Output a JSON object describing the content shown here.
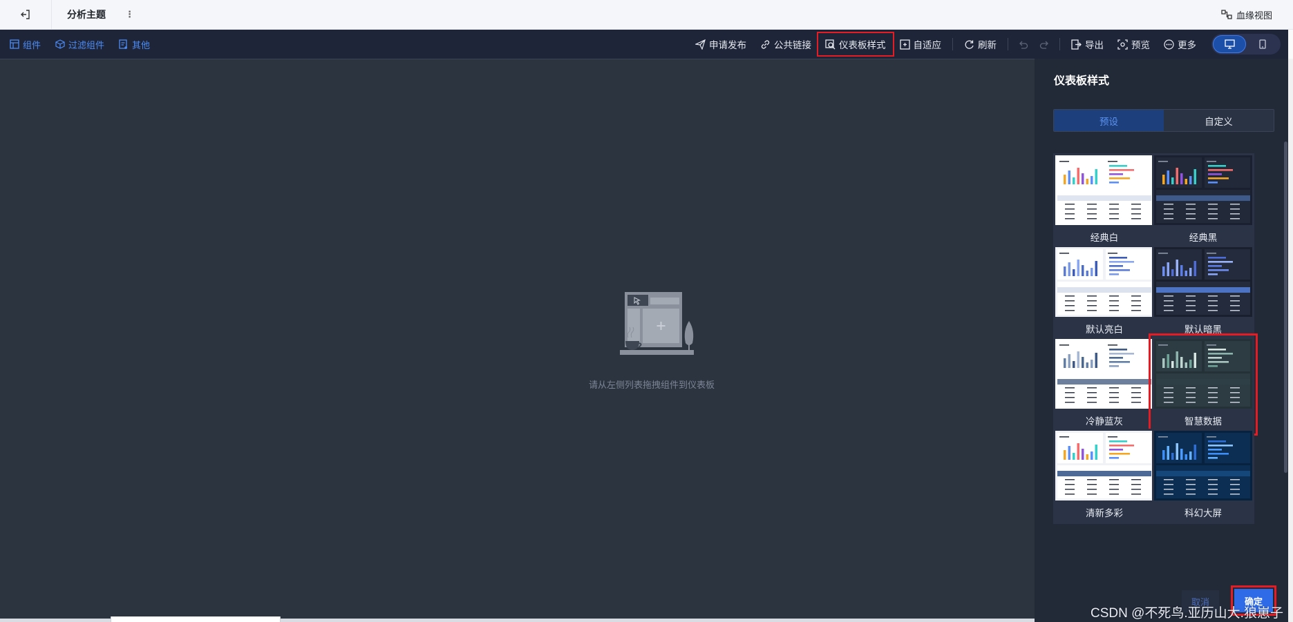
{
  "header": {
    "title": "分析主题",
    "menu_glyph": "⋮",
    "lineage_label": "血缘视图"
  },
  "toolbar": {
    "left": [
      {
        "label": "组件",
        "icon": "component-icon"
      },
      {
        "label": "过滤组件",
        "icon": "filter-cube-icon"
      },
      {
        "label": "其他",
        "icon": "other-add-icon"
      }
    ],
    "publish": "申请发布",
    "public_link": "公共链接",
    "dashboard_style": "仪表板样式",
    "adaptive": "自适应",
    "refresh": "刷新",
    "export": "导出",
    "preview": "预览",
    "more": "更多",
    "device_active": "desktop"
  },
  "canvas": {
    "empty_hint": "请从左侧列表拖拽组件到仪表板",
    "background": "#2c3440"
  },
  "panel": {
    "title": "仪表板样式",
    "tabs": [
      "预设",
      "自定义"
    ],
    "active_tab": "预设",
    "themes": [
      {
        "name": "经典白",
        "theme": "light",
        "bg": "#ffffff",
        "card": "#ffffff",
        "band": "#dfe6f2",
        "bars": [
          "#f5a623",
          "#5b8ff9",
          "#36cfc9",
          "#f56c6c",
          "#9254de"
        ]
      },
      {
        "name": "经典黑",
        "theme": "dark",
        "bg": "#1a2030",
        "card": "#222a3a",
        "band": "#3d5a8a",
        "bars": [
          "#f5a623",
          "#5b8ff9",
          "#36cfc9",
          "#f56c6c",
          "#9254de"
        ]
      },
      {
        "name": "默认亮白",
        "theme": "light",
        "bg": "#f0f2f5",
        "card": "#ffffff",
        "band": "#dde3ee",
        "bars": [
          "#5b7bd5",
          "#7a9ae8",
          "#3c5cb8",
          "#8aa6ee",
          "#4d6cc7"
        ]
      },
      {
        "name": "默认暗黑",
        "theme": "dark",
        "bg": "#1a1f2d",
        "card": "#242b3c",
        "band": "#4d74c4",
        "bars": [
          "#6d8df0",
          "#8aa6f5",
          "#4d6cd8",
          "#9ab2f8",
          "#5d7de6"
        ]
      },
      {
        "name": "冷静蓝灰",
        "theme": "light",
        "bg": "#ffffff",
        "card": "#ffffff",
        "band": "#6c7f9c",
        "bars": [
          "#5f7ea8",
          "#8aa0c2",
          "#3f5a86",
          "#a7b8d4",
          "#4b6893"
        ]
      },
      {
        "name": "智慧数据",
        "theme": "dark",
        "bg": "#243238",
        "card": "#2c3c42",
        "band": "#2e4046",
        "bars": [
          "#a9c7c0",
          "#6fa398",
          "#d8e6e2",
          "#8bb5ac",
          "#c0d7d1"
        ]
      },
      {
        "name": "清新多彩",
        "theme": "light",
        "bg": "#f0f2f5",
        "card": "#ffffff",
        "band": "#4d6a96",
        "bars": [
          "#f5a623",
          "#5b8ff9",
          "#36cfc9",
          "#f56c6c",
          "#9254de"
        ]
      },
      {
        "name": "科幻大屏",
        "theme": "dark",
        "bg": "#07223f",
        "card": "#0b2e52",
        "band": "#15477b",
        "bars": [
          "#3e8ef7",
          "#66b1ff",
          "#2d6fd6",
          "#8cc4ff",
          "#4d9bff"
        ]
      }
    ],
    "selected_theme": "智慧数据",
    "cancel": "取消",
    "ok": "确定"
  },
  "watermark": "CSDN @不死鸟.亚历山大.狼崽子"
}
